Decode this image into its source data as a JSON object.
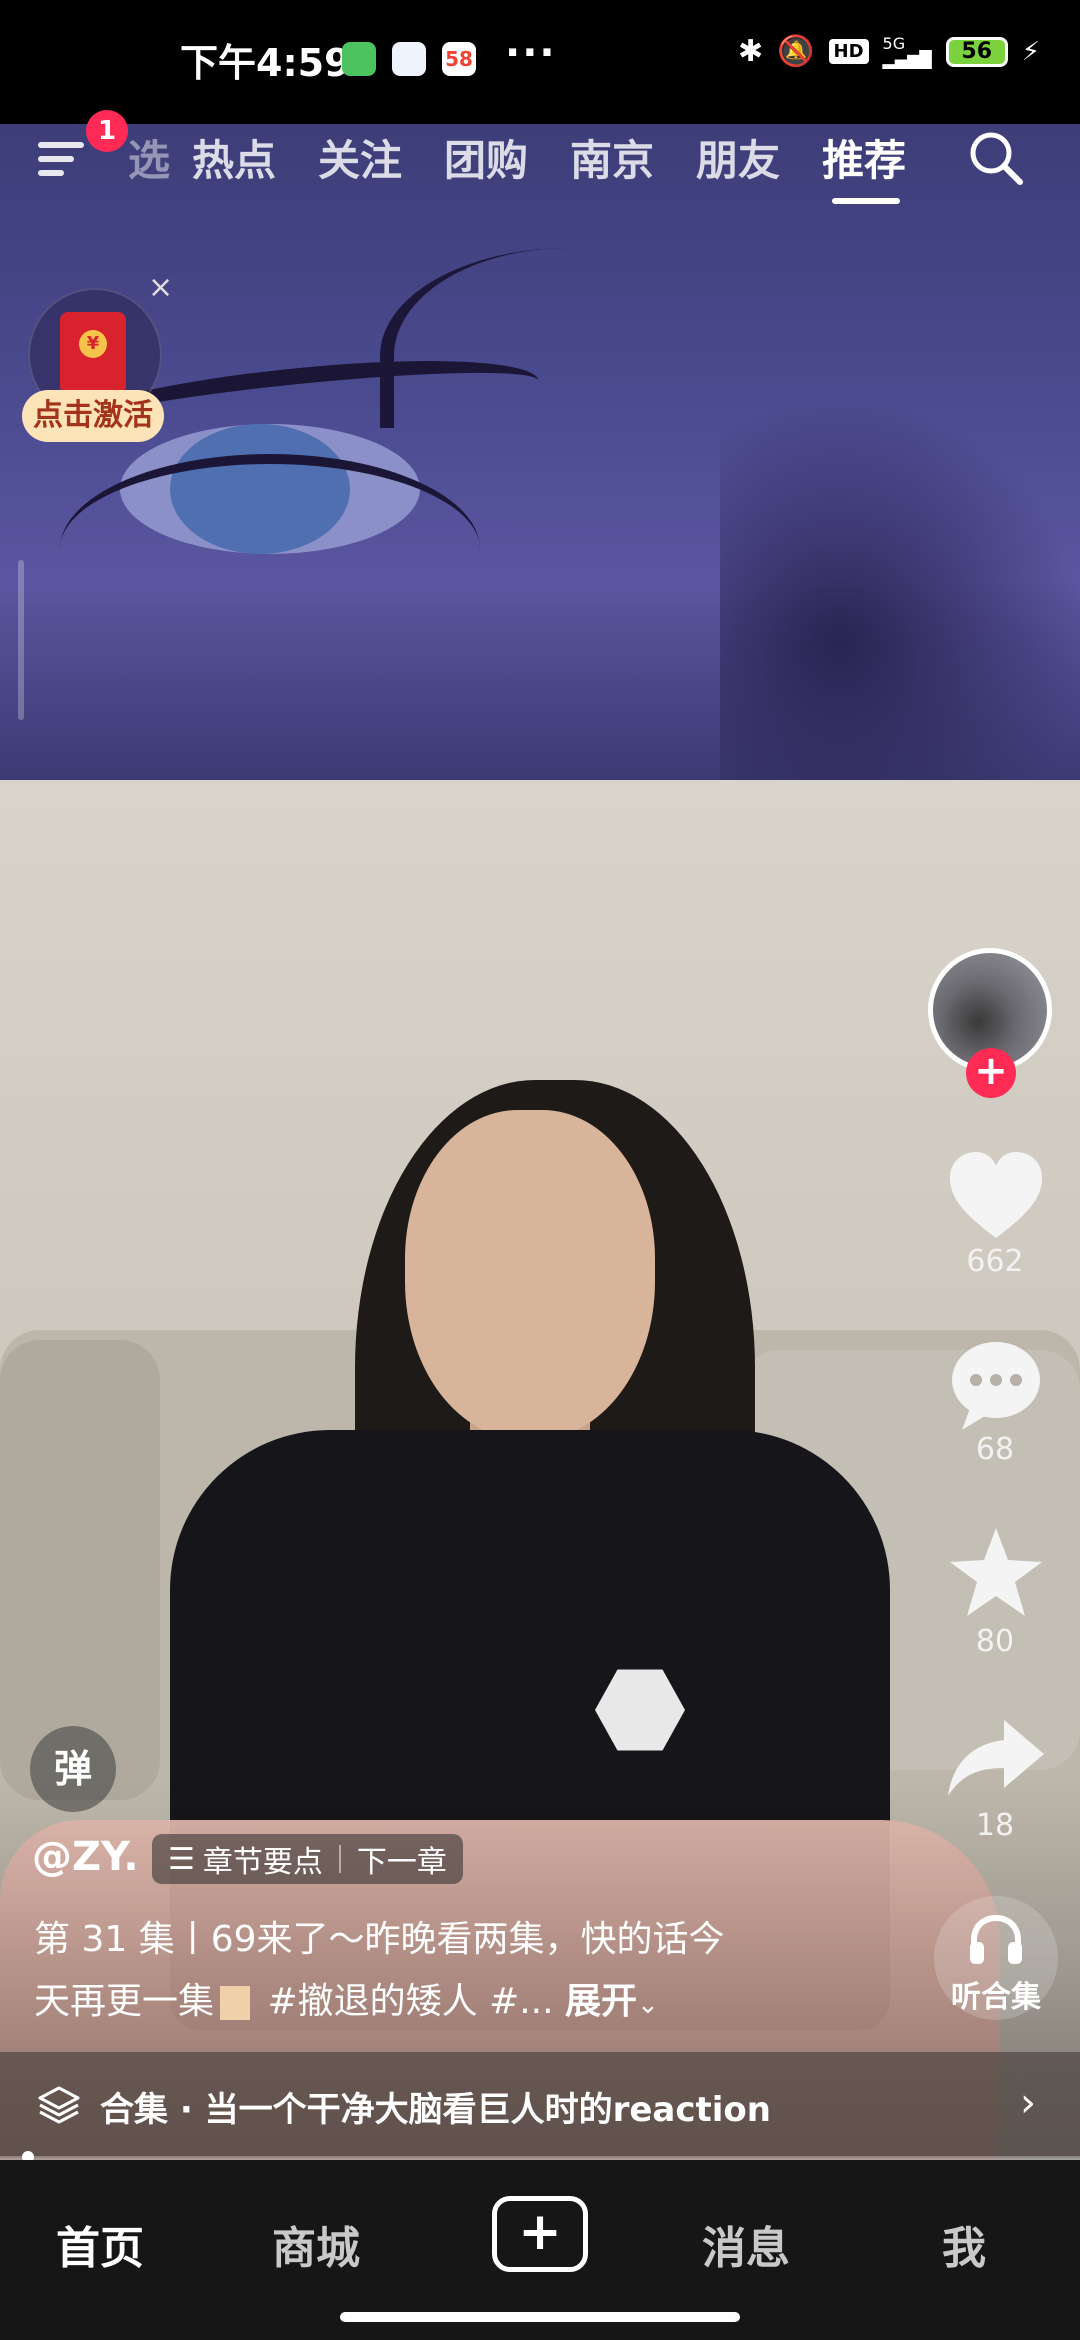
{
  "status_bar": {
    "time": "下午4:59",
    "more": "···",
    "network": "5G",
    "hd_label": "HD",
    "battery": "56",
    "app_icons": [
      "wechat-icon",
      "baidu-netdisk-icon",
      "58-app-icon"
    ]
  },
  "top_nav": {
    "menu_badge": "1",
    "partial_tab": "选",
    "tabs": [
      "热点",
      "关注",
      "团购",
      "南京",
      "朋友",
      "推荐"
    ],
    "active_tab": "推荐"
  },
  "red_packet": {
    "label": "点击激活",
    "close": "×",
    "coin": "¥"
  },
  "side_actions": {
    "likes": "662",
    "comments": "68",
    "favorites": "80",
    "shares": "18",
    "listen_label": "听合集",
    "follow": "+"
  },
  "danmu_label": "弹",
  "caption": {
    "author": "@ZY.",
    "chapter_points": "章节要点",
    "next_chapter": "下一章",
    "line1": "第 31 集丨69来了～昨晚看两集，快的话今",
    "line2_text": "天再更一集",
    "line2_tags": " #撤退的矮人 #...",
    "expand": "展开"
  },
  "collection": {
    "text": "合集 · 当一个干净大脑看巨人时的reaction",
    "chevron": "›"
  },
  "bottom_nav": {
    "items": [
      "首页",
      "商城",
      "消息",
      "我"
    ],
    "active": "首页",
    "plus": "+"
  },
  "colors": {
    "accent": "#fe2c55",
    "nav_bg": "#161616",
    "red_packet_label_bg": "#fde3b8"
  }
}
